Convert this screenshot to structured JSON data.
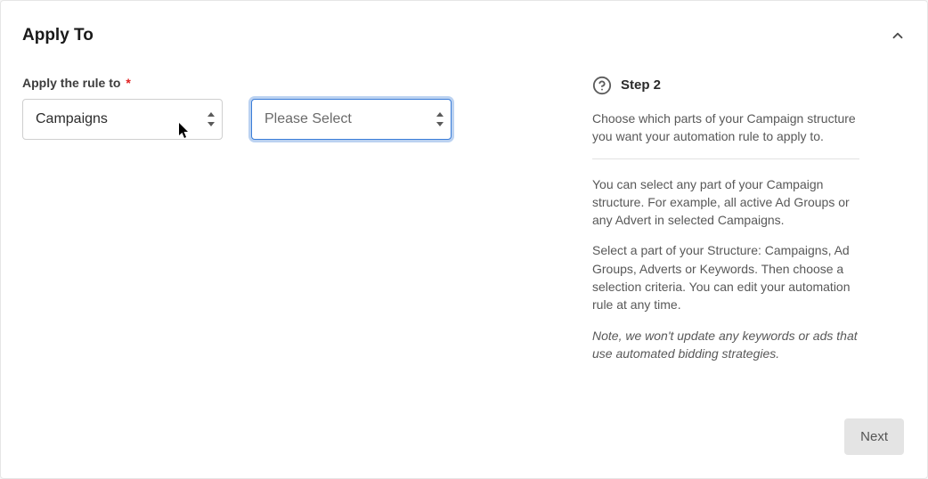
{
  "panel": {
    "title": "Apply To"
  },
  "form": {
    "label": "Apply the rule to",
    "required_mark": "*",
    "structure_select": {
      "value": "Campaigns"
    },
    "criteria_select": {
      "value": "Please Select"
    }
  },
  "help": {
    "step_label": "Step 2",
    "p1": "Choose which parts of your Campaign structure you want your automation rule to apply to.",
    "p2": "You can select any part of your Campaign structure. For example, all active Ad Groups or any Advert in selected Campaigns.",
    "p3": "Select a part of your Structure: Campaigns, Ad Groups, Adverts or Keywords. Then choose a selection criteria. You can edit your automation rule at any time.",
    "p4": "Note, we won't update any keywords or ads that use automated bidding strategies."
  },
  "buttons": {
    "next": "Next"
  }
}
